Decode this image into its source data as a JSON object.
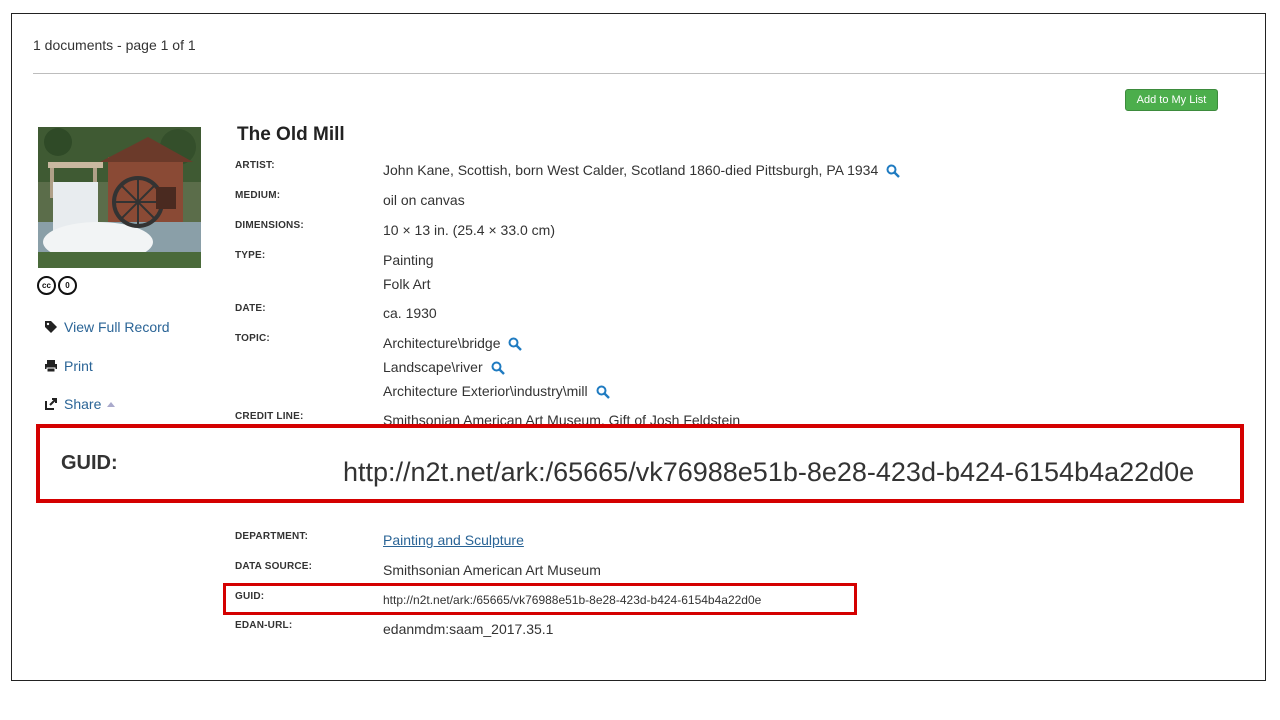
{
  "results": {
    "count_text": "1 documents - page 1 of 1"
  },
  "actions": {
    "add_to_list": "Add to My List"
  },
  "record": {
    "title": "The Old Mill",
    "artist_label": "ARTIST:",
    "artist": "John Kane, Scottish, born West Calder, Scotland 1860-died Pittsburgh, PA 1934",
    "medium_label": "MEDIUM:",
    "medium": "oil on canvas",
    "dimensions_label": "DIMENSIONS:",
    "dimensions": "10 × 13 in. (25.4 × 33.0 cm)",
    "type_label": "TYPE:",
    "types": [
      "Painting",
      "Folk Art"
    ],
    "date_label": "DATE:",
    "date": "ca. 1930",
    "topic_label": "TOPIC:",
    "topics": [
      "Architecture\\bridge",
      "Landscape\\river",
      "Architecture Exterior\\industry\\mill"
    ],
    "credit_label": "CREDIT LINE:",
    "credit": "Smithsonian American Art Museum, Gift of Josh Feldstein",
    "department_label": "DEPARTMENT:",
    "department": "Painting and Sculpture",
    "datasource_label": "DATA SOURCE:",
    "datasource": "Smithsonian American Art Museum",
    "guid_label": "GUID:",
    "guid": "http://n2t.net/ark:/65665/vk76988e51b-8e28-423d-b424-6154b4a22d0e",
    "edan_label": "EDAN-URL:",
    "edan": "edanmdm:saam_2017.35.1"
  },
  "sidebar": {
    "view_full": "View Full Record",
    "print": "Print",
    "share": "Share"
  },
  "license_icons": [
    "cc",
    "0"
  ],
  "callout": {
    "guid_label": "GUID:",
    "guid": "http://n2t.net/ark:/65665/vk76988e51b-8e28-423d-b424-6154b4a22d0e"
  },
  "colors": {
    "accent_link": "#2a6496",
    "button_green": "#4cae4c",
    "callout_red": "#d40000"
  }
}
